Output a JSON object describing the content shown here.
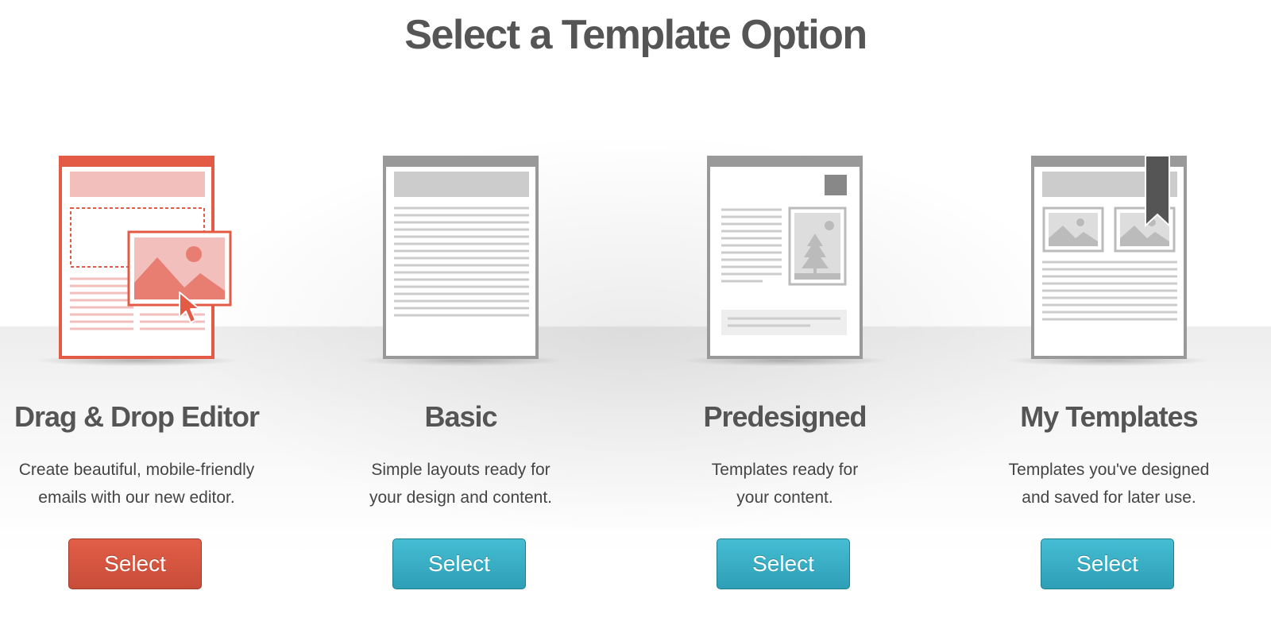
{
  "page": {
    "title": "Select a Template Option"
  },
  "colors": {
    "accent_red": "#e45b45",
    "accent_teal": "#3aaec5",
    "neutral_gray": "#999999"
  },
  "options": [
    {
      "id": "drag-drop",
      "title": "Drag & Drop Editor",
      "description_lines": [
        "Create beautiful, mobile-friendly",
        "emails with our new editor."
      ],
      "button_label": "Select",
      "icon": "drag-drop-editor-icon",
      "active": true
    },
    {
      "id": "basic",
      "title": "Basic",
      "description_lines": [
        "Simple layouts ready for",
        "your design and content."
      ],
      "button_label": "Select",
      "icon": "basic-template-icon",
      "active": false
    },
    {
      "id": "predesigned",
      "title": "Predesigned",
      "description_lines": [
        "Templates ready for",
        "your content."
      ],
      "button_label": "Select",
      "icon": "predesigned-template-icon",
      "active": false
    },
    {
      "id": "my-templates",
      "title": "My Templates",
      "description_lines": [
        "Templates you've designed",
        "and saved for later use."
      ],
      "button_label": "Select",
      "icon": "my-templates-icon",
      "active": false
    }
  ]
}
